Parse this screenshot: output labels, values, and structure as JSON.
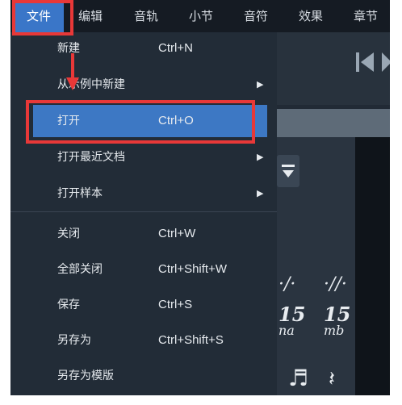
{
  "menubar": {
    "items": [
      "文件",
      "编辑",
      "音轨",
      "小节",
      "音符",
      "效果",
      "章节"
    ]
  },
  "file_menu": {
    "items": [
      {
        "label": "新建",
        "shortcut": "Ctrl+N"
      },
      {
        "label": "从示例中新建",
        "shortcut": "",
        "submenu": true
      },
      {
        "label": "打开",
        "shortcut": "Ctrl+O"
      },
      {
        "label": "打开最近文档",
        "shortcut": "",
        "submenu": true
      },
      {
        "label": "打开样本",
        "shortcut": "",
        "submenu": true
      },
      {
        "label": "关闭",
        "shortcut": "Ctrl+W"
      },
      {
        "label": "全部关闭",
        "shortcut": "Ctrl+Shift+W"
      },
      {
        "label": "保存",
        "shortcut": "Ctrl+S"
      },
      {
        "label": "另存为",
        "shortcut": "Ctrl+Shift+S"
      },
      {
        "label": "另存为模版",
        "shortcut": ""
      }
    ]
  },
  "right_panel": {
    "symbol_a": "15",
    "symbol_a_sub": "na",
    "symbol_b": "15",
    "symbol_b_sub": "mb"
  },
  "colors": {
    "highlight": "#3d78c4",
    "annotation": "#e83838",
    "menu_bg": "#222c37",
    "menubar_bg": "#151b23"
  },
  "icons": [
    "skip-back-icon",
    "play-icon",
    "sort-icon",
    "submenu-arrow-icon",
    "note-icon",
    "rest-icon",
    "repeat-icon"
  ]
}
